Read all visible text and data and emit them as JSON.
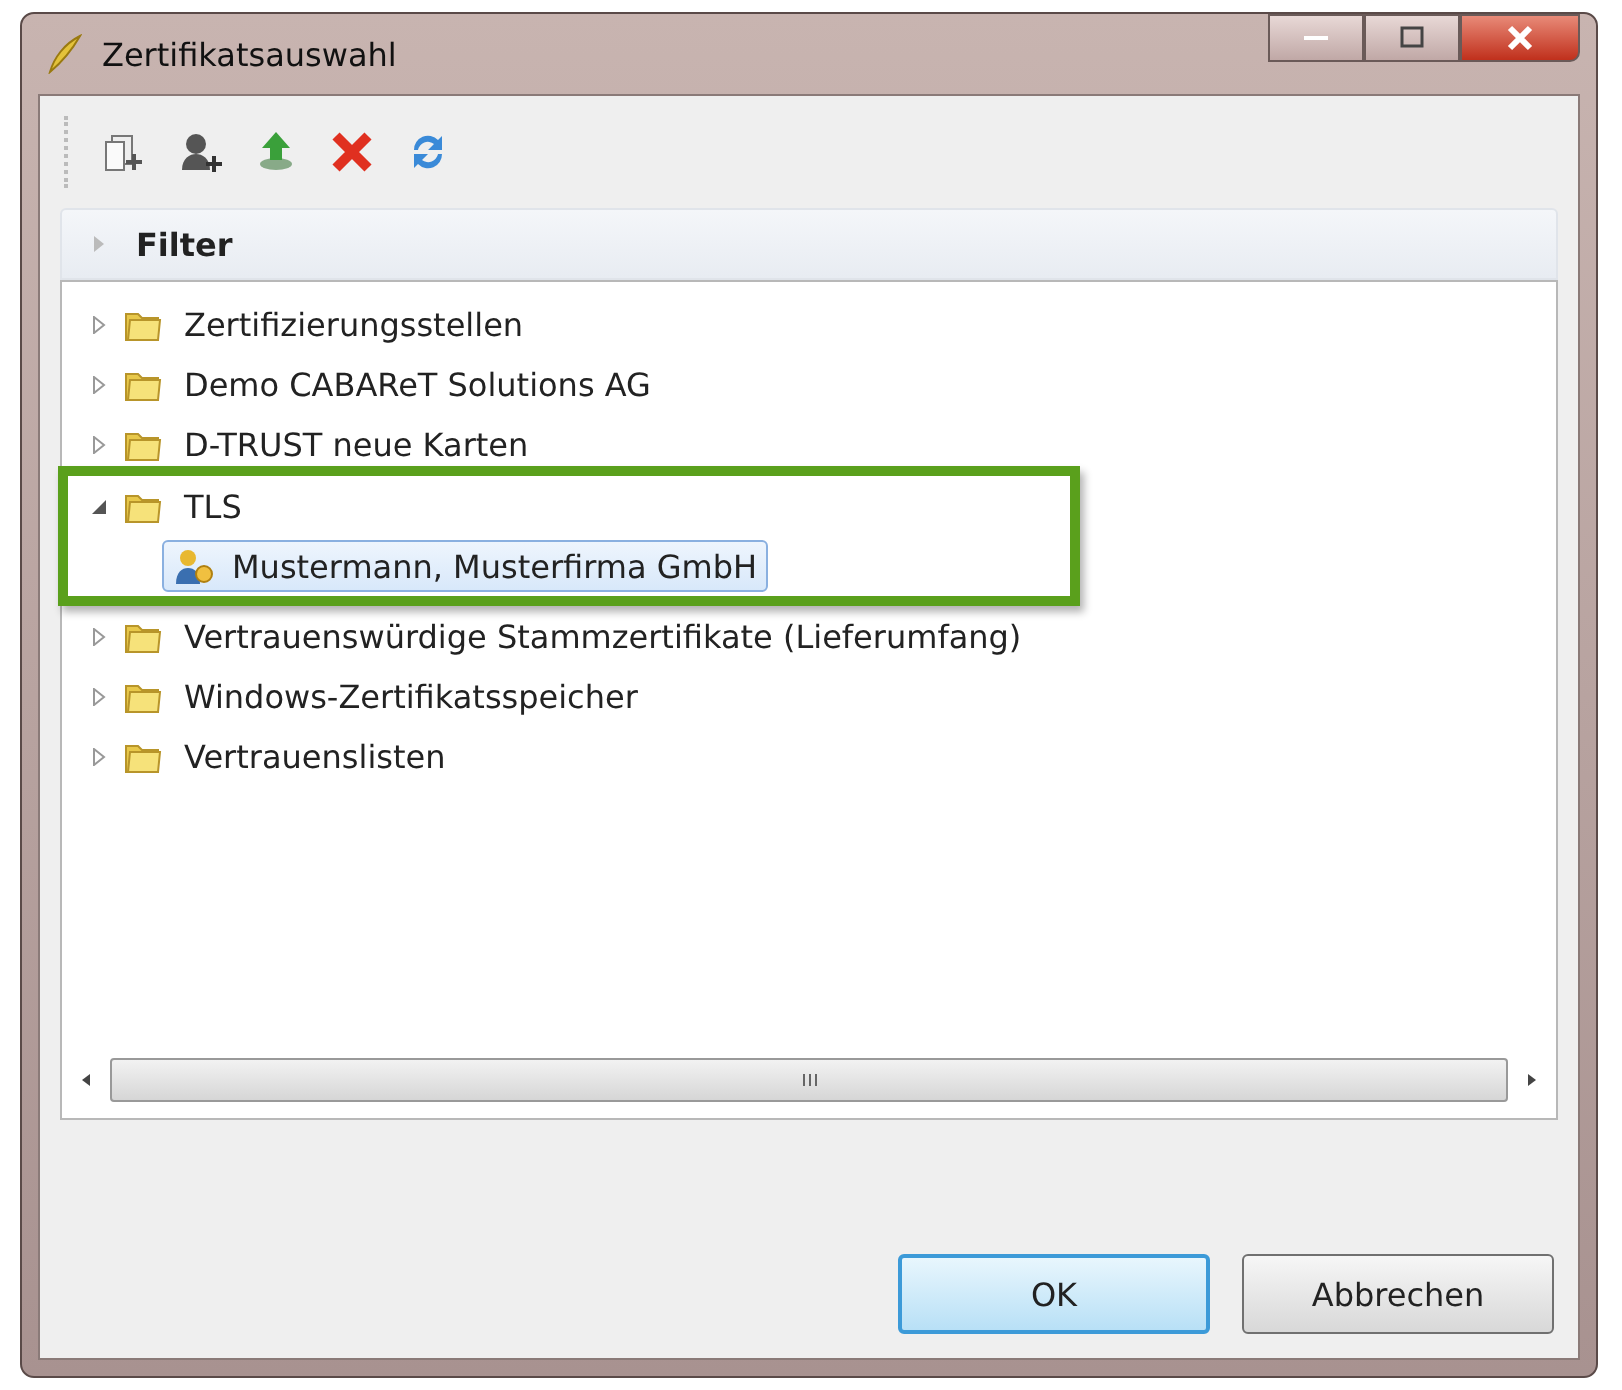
{
  "window": {
    "title": "Zertifikatsauswahl"
  },
  "filter": {
    "label": "Filter",
    "expanded": false
  },
  "tree": [
    {
      "label": "Zertifizierungsstellen",
      "expanded": false,
      "selected": false,
      "highlighted": false
    },
    {
      "label": "Demo CABAReT Solutions AG",
      "expanded": false,
      "selected": false,
      "highlighted": false
    },
    {
      "label": "D-TRUST neue Karten",
      "expanded": false,
      "selected": false,
      "highlighted": false
    },
    {
      "label": "TLS",
      "expanded": true,
      "selected": false,
      "highlighted": true,
      "children": [
        {
          "label": "Mustermann, Musterfirma GmbH",
          "kind": "certificate",
          "selected": true
        }
      ]
    },
    {
      "label": "Vertrauenswürdige Stammzertifikate (Lieferumfang)",
      "expanded": false,
      "selected": false,
      "highlighted": false
    },
    {
      "label": "Windows-Zertifikatsspeicher",
      "expanded": false,
      "selected": false,
      "highlighted": false
    },
    {
      "label": "Vertrauenslisten",
      "expanded": false,
      "selected": false,
      "highlighted": false
    }
  ],
  "buttons": [
    {
      "label": "OK",
      "default": true
    },
    {
      "label": "Abbrechen",
      "default": false
    }
  ]
}
